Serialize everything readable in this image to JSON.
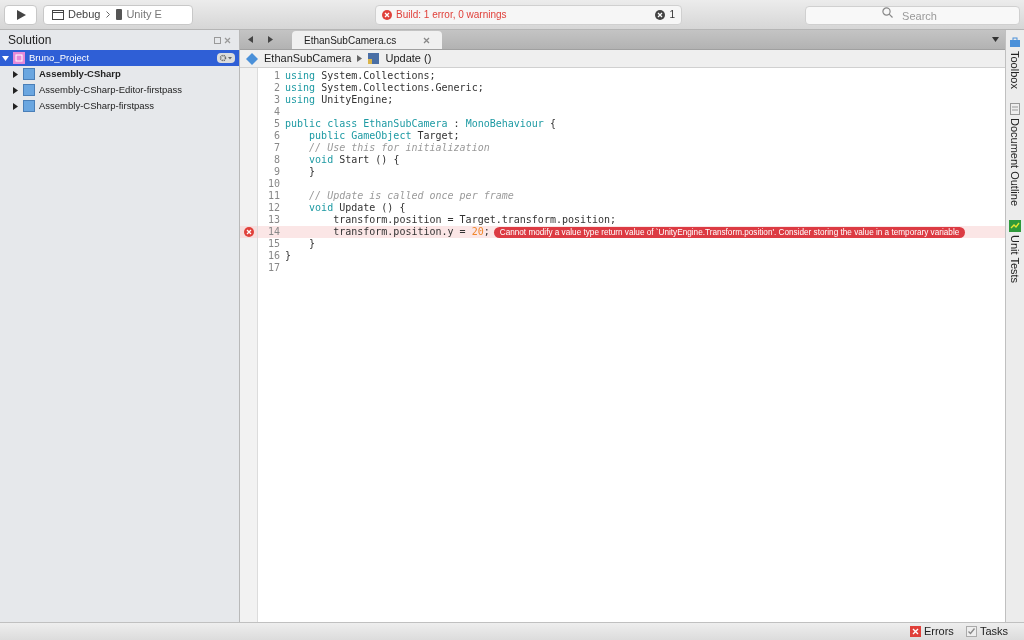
{
  "toolbar": {
    "configuration": "Debug",
    "target": "Unity E",
    "build_status": "Build: 1 error, 0 warnings",
    "error_count": "1",
    "search": {
      "placeholder": "Search"
    }
  },
  "solution": {
    "title": "Solution",
    "items": [
      {
        "label": "Bruno_Project",
        "selected": true,
        "expanded": true,
        "bold": false,
        "children": [
          {
            "label": "Assembly-CSharp",
            "selected": false,
            "expanded": false,
            "bold": true
          },
          {
            "label": "Assembly-CSharp-Editor-firstpass",
            "selected": false,
            "expanded": false,
            "bold": false
          },
          {
            "label": "Assembly-CSharp-firstpass",
            "selected": false,
            "expanded": false,
            "bold": false
          }
        ]
      }
    ]
  },
  "tabs": [
    {
      "label": "EthanSubCamera.cs",
      "selected": true
    }
  ],
  "breadcrumb": [
    "EthanSubCamera",
    "Update ()"
  ],
  "code": [
    {
      "number": "1",
      "error": false,
      "tokens": [
        {
          "kind": "keyword",
          "text": "using"
        },
        {
          "kind": "plain",
          "text": " System.Collections;"
        }
      ]
    },
    {
      "number": "2",
      "error": false,
      "tokens": [
        {
          "kind": "keyword",
          "text": "using"
        },
        {
          "kind": "plain",
          "text": " System.Collections.Generic;"
        }
      ]
    },
    {
      "number": "3",
      "error": false,
      "tokens": [
        {
          "kind": "keyword",
          "text": "using"
        },
        {
          "kind": "plain",
          "text": " UnityEngine;"
        }
      ]
    },
    {
      "number": "4",
      "error": false
    },
    {
      "number": "5",
      "error": false,
      "tokens": [
        {
          "kind": "keyword",
          "text": "public class EthanSubCamera"
        },
        {
          "kind": "plain",
          "text": " : "
        },
        {
          "kind": "keyword",
          "text": "MonoBehaviour"
        },
        {
          "kind": "plain",
          "text": " {"
        }
      ]
    },
    {
      "number": "6",
      "error": false,
      "tokens": [
        {
          "kind": "keyword",
          "text": "    public GameObject"
        },
        {
          "kind": "plain",
          "text": " Target;"
        }
      ]
    },
    {
      "number": "7",
      "error": false,
      "tokens": [
        {
          "kind": "comment",
          "text": "    // Use this for initialization"
        }
      ]
    },
    {
      "number": "8",
      "error": false,
      "tokens": [
        {
          "kind": "keyword",
          "text": "    void"
        },
        {
          "kind": "plain",
          "text": " Start () {"
        }
      ]
    },
    {
      "number": "9",
      "error": false,
      "tokens": [
        {
          "kind": "plain",
          "text": "    }"
        }
      ]
    },
    {
      "number": "10",
      "error": false
    },
    {
      "number": "11",
      "error": false,
      "tokens": [
        {
          "kind": "comment",
          "text": "    // Update is called once per frame"
        }
      ]
    },
    {
      "number": "12",
      "error": false,
      "tokens": [
        {
          "kind": "keyword",
          "text": "    void"
        },
        {
          "kind": "plain",
          "text": " Update () {"
        }
      ]
    },
    {
      "number": "13",
      "error": false,
      "tokens": [
        {
          "kind": "plain",
          "text": "        transform.position = Target.transform.position;"
        }
      ]
    },
    {
      "number": "14",
      "error": true,
      "tokens": [
        {
          "kind": "plain",
          "text": "        transform.position.y = "
        },
        {
          "kind": "number",
          "text": "20"
        },
        {
          "kind": "plain",
          "text": ";"
        }
      ],
      "message": "Cannot modify a value type return value of `UnityEngine.Transform.position'. Consider storing the value in a temporary variable"
    },
    {
      "number": "15",
      "error": false,
      "tokens": [
        {
          "kind": "plain",
          "text": "    }"
        }
      ]
    },
    {
      "number": "16",
      "error": false,
      "tokens": [
        {
          "kind": "plain",
          "text": "}"
        }
      ]
    },
    {
      "number": "17",
      "error": false
    }
  ],
  "side_pads": [
    "Toolbox",
    "Document Outline",
    "Unit Tests"
  ],
  "status_bar": [
    {
      "kind": "errors",
      "label": "Errors"
    },
    {
      "kind": "tasks",
      "label": "Tasks"
    }
  ]
}
